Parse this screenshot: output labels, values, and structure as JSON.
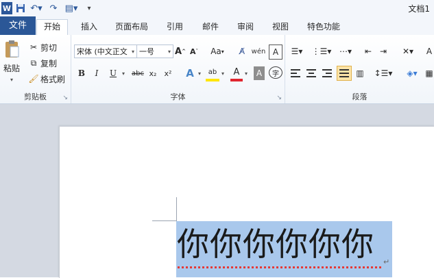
{
  "window": {
    "title": "文档1"
  },
  "qat": {
    "app_icon": "word-icon",
    "save_icon": "save-icon",
    "undo_icon": "undo-icon",
    "redo_icon": "redo-icon",
    "customize_icon": "customize-icon"
  },
  "tabs": [
    {
      "label": "文件"
    },
    {
      "label": "开始"
    },
    {
      "label": "插入"
    },
    {
      "label": "页面布局"
    },
    {
      "label": "引用"
    },
    {
      "label": "邮件"
    },
    {
      "label": "审阅"
    },
    {
      "label": "视图"
    },
    {
      "label": "特色功能"
    }
  ],
  "clipboard": {
    "group_label": "剪贴板",
    "paste_label": "粘贴",
    "cut_label": "剪切",
    "copy_label": "复制",
    "format_painter_label": "格式刷"
  },
  "font": {
    "group_label": "字体",
    "font_name": "宋体 (中文正文",
    "font_size": "一号",
    "grow_label": "A",
    "shrink_label": "A",
    "case_label": "Aa",
    "bold": "B",
    "italic": "I",
    "underline": "U",
    "strike": "abc",
    "subscript": "x₂",
    "superscript": "x²",
    "text_effect": "A",
    "highlight": "ab",
    "font_color": "A",
    "char_shading": "A",
    "enclose": "字"
  },
  "paragraph": {
    "group_label": "段落"
  },
  "document": {
    "text": "你你你你你你",
    "paragraph_mark": "↵"
  }
}
